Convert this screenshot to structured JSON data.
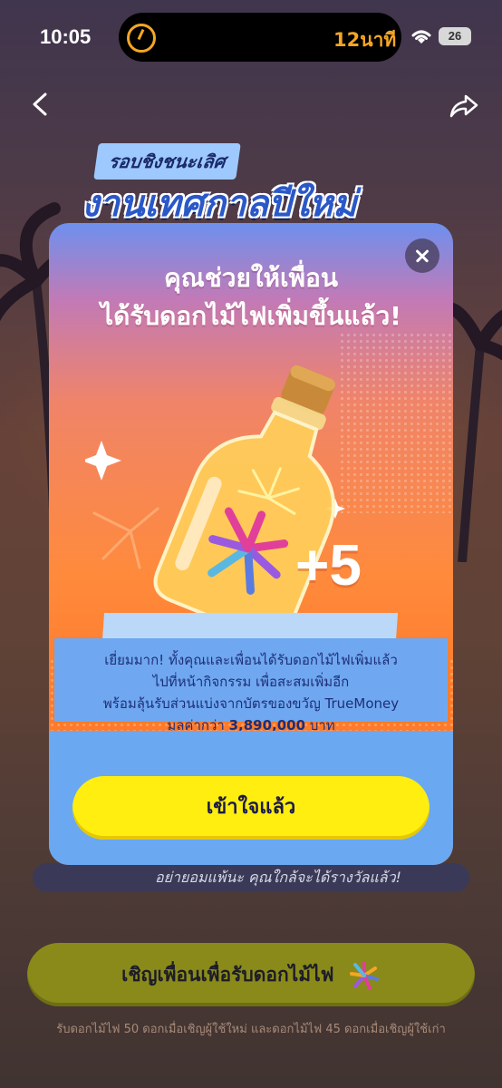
{
  "status_bar": {
    "time": "10:05",
    "island_time": "12นาที",
    "battery": "26"
  },
  "event": {
    "subtitle": "รอบชิงชนะเลิศ",
    "title": "งานเทศกาลปีใหม่"
  },
  "modal": {
    "title_line1": "คุณช่วยให้เพื่อน",
    "title_line2": "ได้รับดอกไม้ไฟเพิ่มขึ้นแล้ว!",
    "bonus": "+5",
    "info_line1": "เยี่ยมมาก! ทั้งคุณและเพื่อนได้รับดอกไม้ไฟเพิ่มแล้ว",
    "info_line2": "ไปที่หน้ากิจกรรม เพื่อสะสมเพิ่มอีก",
    "info_line3": "พร้อมลุ้นรับส่วนแบ่งจากบัตรของขวัญ TrueMoney",
    "info_line4_prefix": "มูลค่ากว่า",
    "info_amount": "3,890,000",
    "info_line4_suffix": "บาท",
    "ok_label": "เข้าใจแล้ว"
  },
  "page": {
    "encourage_text": "อย่ายอมแพ้นะ คุณใกล้จะได้รางวัลแล้ว!",
    "invite_label": "เชิญเพื่อนเพื่อรับดอกไม้ไฟ",
    "footnote": "รับดอกไม้ไฟ 50 ดอกเมื่อเชิญผู้ใช้ใหม่ และดอกไม้ไฟ 45 ดอกเมื่อเชิญผู้ใช้เก่า"
  },
  "icons": {
    "back": "chevron-left-icon",
    "share": "share-icon",
    "close": "close-icon",
    "timer": "timer-icon",
    "wifi": "wifi-icon",
    "firework": "firework-icon"
  },
  "colors": {
    "ok_button": "#ffee10",
    "modal_orange": "#ff8a3c",
    "info_blue": "#6fa8f0",
    "info_text": "#1e2f78"
  }
}
